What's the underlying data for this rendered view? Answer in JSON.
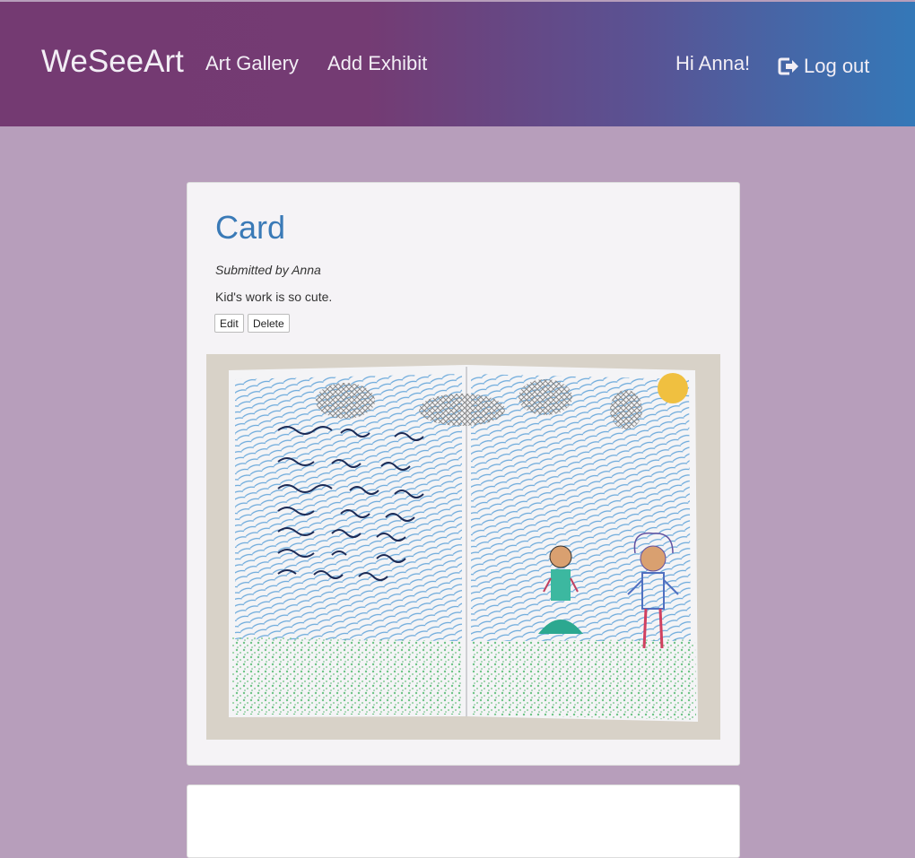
{
  "nav": {
    "brand": "WeSeeArt",
    "links": [
      "Art Gallery",
      "Add Exhibit"
    ],
    "greeting": "Hi Anna!",
    "logout": "Log out"
  },
  "exhibit": {
    "title": "Card",
    "submitted_by": "Submitted by Anna",
    "description": "Kid's work is so cute.",
    "edit_label": "Edit",
    "delete_label": "Delete"
  },
  "colors": {
    "page_bg": "#b79ebb",
    "nav_start": "#743a72",
    "nav_end": "#3478b8",
    "title": "#3a7ab7"
  }
}
